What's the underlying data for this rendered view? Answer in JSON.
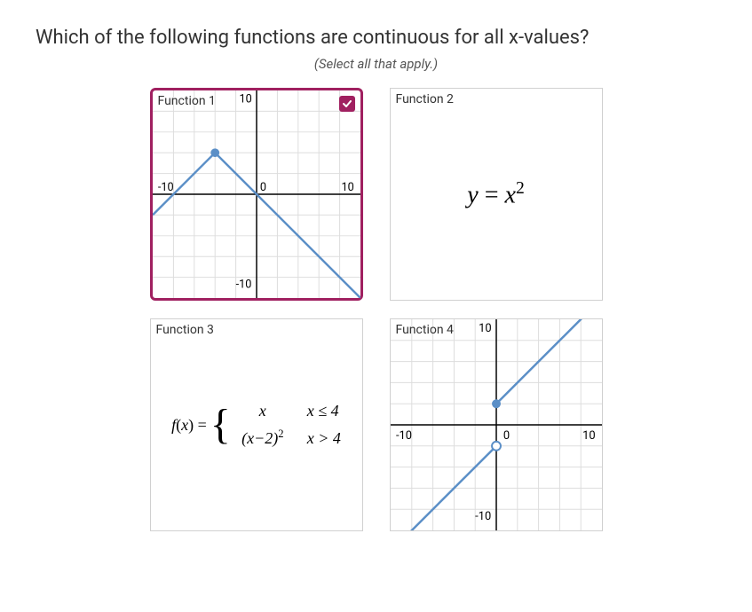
{
  "question": "Which of the following functions are continuous for all x-values?",
  "instruction": "(Select all that apply.)",
  "cards": {
    "f1": {
      "label": "Function 1",
      "selected": true
    },
    "f2": {
      "label": "Function 2",
      "formula_html": "<span class='sq'>y</span> = <span class='sq'>x</span><sup>2</sup>"
    },
    "f3": {
      "label": "Function 3",
      "lhs_html": "<span class='sq'>f</span>(<span class='sq'>x</span>) =",
      "row1_expr_html": "<span class='sq'>x</span>",
      "row1_cond_html": "<span class='sq'>x</span> ≤ 4",
      "row2_expr_html": "(<span class='sq'>x</span>−2)<sup>2</sup>",
      "row2_cond_html": "<span class='sq'>x</span> > 4"
    },
    "f4": {
      "label": "Function 4"
    }
  },
  "axis": {
    "neg10": "-10",
    "pos10": "10",
    "zero": "0"
  },
  "chart_data": [
    {
      "id": "f1",
      "type": "line",
      "xlim": [
        -10,
        10
      ],
      "ylim": [
        -10,
        10
      ],
      "xticks": [
        -10,
        0,
        10
      ],
      "yticks": [
        -10,
        10
      ],
      "grid": true,
      "series": [
        {
          "name": "f1-left",
          "x": [
            -10,
            -4
          ],
          "y": [
            -2,
            4
          ],
          "endpoint_filled": true
        },
        {
          "name": "f1-right",
          "x": [
            -4,
            10
          ],
          "y": [
            4,
            -10
          ]
        }
      ],
      "points": [
        {
          "x": -4,
          "y": 4,
          "style": "closed"
        }
      ]
    },
    {
      "id": "f4",
      "type": "line",
      "xlim": [
        -10,
        10
      ],
      "ylim": [
        -10,
        10
      ],
      "xticks": [
        -10,
        0,
        10
      ],
      "yticks": [
        -10,
        10
      ],
      "grid": true,
      "series": [
        {
          "name": "f4-upper",
          "x": [
            0,
            10
          ],
          "y": [
            2,
            12
          ]
        },
        {
          "name": "f4-lower",
          "x": [
            -10,
            0
          ],
          "y": [
            -12,
            -2
          ]
        }
      ],
      "points": [
        {
          "x": 0,
          "y": 2,
          "style": "closed"
        },
        {
          "x": 0,
          "y": -2,
          "style": "open"
        }
      ]
    }
  ]
}
